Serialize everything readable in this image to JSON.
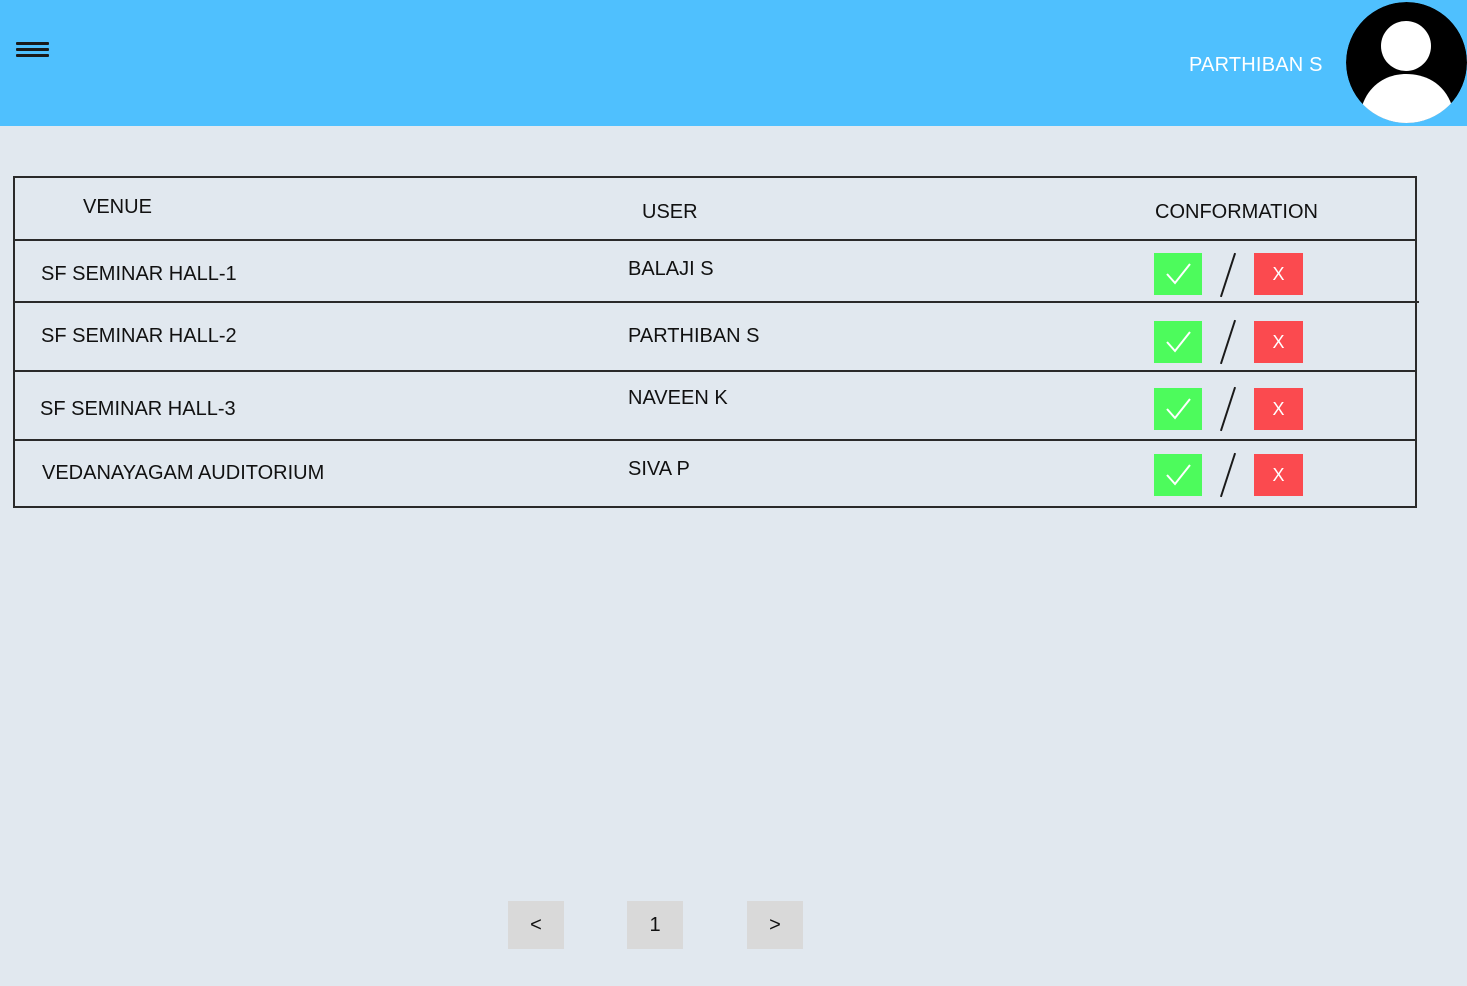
{
  "header": {
    "username": "PARTHIBAN S",
    "background_color": "#4fc0fe",
    "menu_icon": "hamburger-menu-icon",
    "avatar_icon": "user-avatar-icon"
  },
  "table": {
    "columns": [
      "VENUE",
      "USER",
      "CONFORMATION"
    ],
    "rows": [
      {
        "venue": "SF SEMINAR HALL-1",
        "user": "BALAJI S",
        "accept_icon": "checkmark-icon",
        "separator": "/",
        "reject_label": "X"
      },
      {
        "venue": "SF SEMINAR HALL-2",
        "user": "PARTHIBAN S",
        "accept_icon": "checkmark-icon",
        "separator": "/",
        "reject_label": "X"
      },
      {
        "venue": "SF SEMINAR HALL-3",
        "user": "NAVEEN K",
        "accept_icon": "checkmark-icon",
        "separator": "/",
        "reject_label": "X"
      },
      {
        "venue": "VEDANAYAGAM AUDITORIUM",
        "user": "SIVA P",
        "accept_icon": "checkmark-icon",
        "separator": "/",
        "reject_label": "X"
      }
    ],
    "accept_color": "#4dfb5c",
    "reject_color": "#fb4a4f"
  },
  "pagination": {
    "prev_label": "<",
    "current_page": "1",
    "next_label": ">"
  }
}
